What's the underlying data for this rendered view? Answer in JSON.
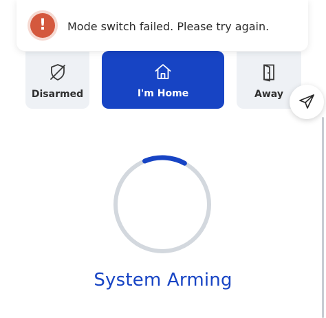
{
  "toast": {
    "icon": "exclamation-icon",
    "message": "Mode switch failed. Please try again."
  },
  "modes": {
    "disarmed": {
      "label": "Disarmed",
      "icon": "shield-off-icon"
    },
    "home": {
      "label": "I'm Home",
      "icon": "house-icon"
    },
    "away": {
      "label": "Away",
      "icon": "door-icon"
    }
  },
  "fab": {
    "icon": "paper-plane-icon"
  },
  "status": {
    "label": "System Arming",
    "progress": 0.14
  },
  "colors": {
    "accent": "#1744c4",
    "error": "#d4583d",
    "ring_track": "#d3d8de"
  }
}
